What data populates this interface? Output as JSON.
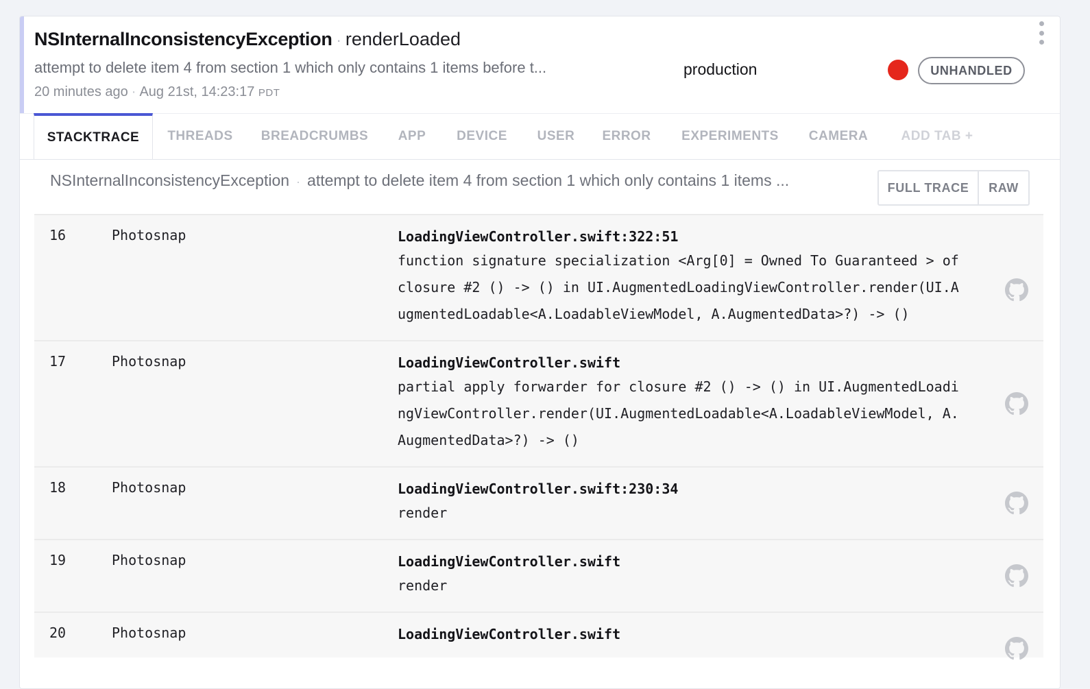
{
  "header": {
    "error_class": "NSInternalInconsistencyException",
    "context": "renderLoaded",
    "message": "attempt to delete item 4 from section 1 which only contains 1 items before t...",
    "relative_time": "20 minutes ago",
    "timestamp": "Aug 21st, 14:23:17",
    "timezone": "PDT",
    "release_stage": "production",
    "severity_color": "#e5271c",
    "handled_badge": "UNHANDLED"
  },
  "tabs": [
    {
      "label": "STACKTRACE",
      "active": true
    },
    {
      "label": "THREADS"
    },
    {
      "label": "BREADCRUMBS"
    },
    {
      "label": "APP"
    },
    {
      "label": "DEVICE"
    },
    {
      "label": "USER"
    },
    {
      "label": "ERROR"
    },
    {
      "label": "EXPERIMENTS"
    },
    {
      "label": "CAMERA"
    },
    {
      "label": "ADD TAB +"
    }
  ],
  "exception": {
    "class": "NSInternalInconsistencyException",
    "message": "attempt to delete item 4 from section 1 which only contains 1 items ...",
    "full_trace_label": "FULL TRACE",
    "raw_label": "RAW"
  },
  "frames": [
    {
      "index": "16",
      "library": "Photosnap",
      "file": "LoadingViewController.swift:322:51",
      "method": "function signature specialization <Arg[0] = Owned To Guaranteed > of closure #2 () -> () in UI.AugmentedLoadingViewController.render(UI.AugmentedLoadable<A.LoadableViewModel, A.AugmentedData>?) -> ()"
    },
    {
      "index": "17",
      "library": "Photosnap",
      "file": "LoadingViewController.swift",
      "method": "partial apply forwarder for closure #2 () -> () in UI.AugmentedLoadingViewController.render(UI.AugmentedLoadable<A.LoadableViewModel, A.AugmentedData>?) -> ()"
    },
    {
      "index": "18",
      "library": "Photosnap",
      "file": "LoadingViewController.swift:230:34",
      "method": "render"
    },
    {
      "index": "19",
      "library": "Photosnap",
      "file": "LoadingViewController.swift",
      "method": "render"
    },
    {
      "index": "20",
      "library": "Photosnap",
      "file": "LoadingViewController.swift",
      "method": ""
    }
  ],
  "icons": {
    "frame_link": "github-icon",
    "menu": "kebab-menu-icon"
  }
}
